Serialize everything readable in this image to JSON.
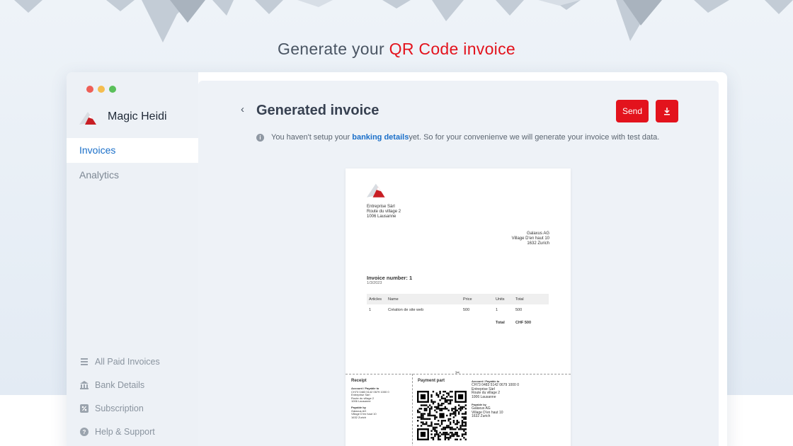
{
  "headline": {
    "prefix": "Generate your ",
    "accent": "QR Code invoice"
  },
  "app": {
    "name": "Magic Heidi"
  },
  "colors": {
    "brand_red": "#e3131d",
    "link_blue": "#1a6fc9"
  },
  "sidebar": {
    "nav": [
      {
        "label": "Invoices",
        "active": true
      },
      {
        "label": "Analytics",
        "active": false
      }
    ],
    "footer": [
      {
        "label": "All Paid Invoices",
        "icon": "list-icon"
      },
      {
        "label": "Bank Details",
        "icon": "bank-icon"
      },
      {
        "label": "Subscription",
        "icon": "percent-badge-icon"
      },
      {
        "label": "Help & Support",
        "icon": "help-icon"
      }
    ]
  },
  "main": {
    "title": "Generated invoice",
    "send_label": "Send",
    "info": {
      "before": "You haven't setup your ",
      "link": "banking details",
      "after": " yet. So for your convenienve we will generate your invoice with test data."
    }
  },
  "invoice": {
    "sender": [
      "Entreprise Sàrl",
      "Route du village 2",
      "1006 Lausanne"
    ],
    "receiver": [
      "Galaxus AG",
      "Village D'en haut 10",
      "1632 Zurich"
    ],
    "number": "Invoice number: 1",
    "date": "1/3/2023",
    "columns": [
      "Articles",
      "Name",
      "Price",
      "Units",
      "Total"
    ],
    "rows": [
      [
        "1",
        "Création de site web",
        "500",
        "1",
        "500"
      ]
    ],
    "total_label": "Total",
    "total_value": "CHF 500",
    "receipt": {
      "title": "Receipt",
      "lines": [
        "Account / Payable to",
        "CH73 0483 5142 0679 1000 0",
        "Entreprise Sàrl",
        "Route du village 2",
        "1006 Lausanne",
        "",
        "Payable by",
        "Galaxus AG",
        "Village D'en haut 10",
        "1632 Zurich"
      ]
    },
    "payment": {
      "title": "Payment part",
      "account_label": "Account / Payable to",
      "account_lines": [
        "CH73 0483 5142 0679 1000 0",
        "Entreprise Sàrl",
        "Route du village 2",
        "1006 Lausanne"
      ],
      "payable_by_label": "Payable by",
      "payable_by_lines": [
        "Galaxus AG",
        "Village D'en haut 10",
        "1632 Zurich"
      ]
    }
  }
}
